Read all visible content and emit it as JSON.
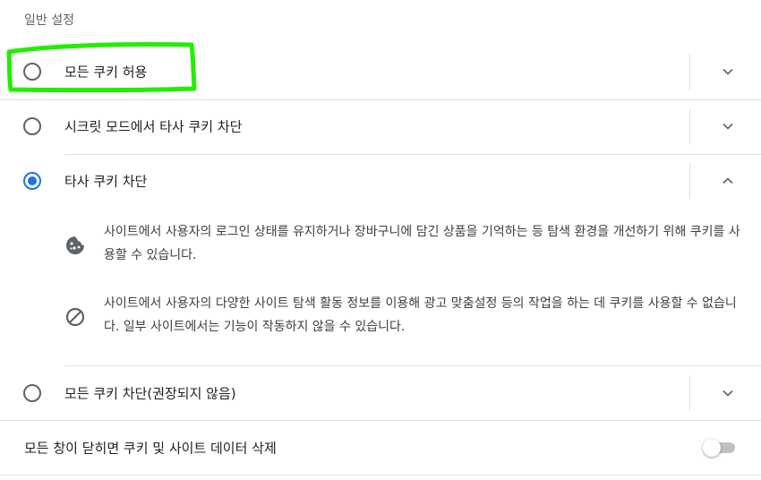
{
  "section": {
    "title": "일반 설정"
  },
  "options": [
    {
      "label": "모든 쿠키 허용",
      "selected": false,
      "expanded": false
    },
    {
      "label": "시크릿 모드에서 타사 쿠키 차단",
      "selected": false,
      "expanded": false
    },
    {
      "label": "타사 쿠키 차단",
      "selected": true,
      "expanded": true
    },
    {
      "label": "모든 쿠키 차단(권장되지 않음)",
      "selected": false,
      "expanded": false
    }
  ],
  "details": [
    {
      "icon": "cookie-icon",
      "text": "사이트에서 사용자의 로그인 상태를 유지하거나 장바구니에 담긴 상품을 기억하는 등 탐색 환경을 개선하기 위해 쿠키를 사용할 수 있습니다."
    },
    {
      "icon": "block-icon",
      "text": "사이트에서 사용자의 다양한 사이트 탐색 활동 정보를 이용해 광고 맞춤설정 등의 작업을 하는 데 쿠키를 사용할 수 없습니다. 일부 사이트에서는 기능이 작동하지 않을 수 있습니다."
    }
  ],
  "toggle": {
    "label": "모든 창이 닫히면 쿠키 및 사이트 데이터 삭제",
    "enabled": false
  },
  "colors": {
    "accent": "#1a73e8",
    "highlight": "#22ee00",
    "divider": "#e0e0e0"
  }
}
